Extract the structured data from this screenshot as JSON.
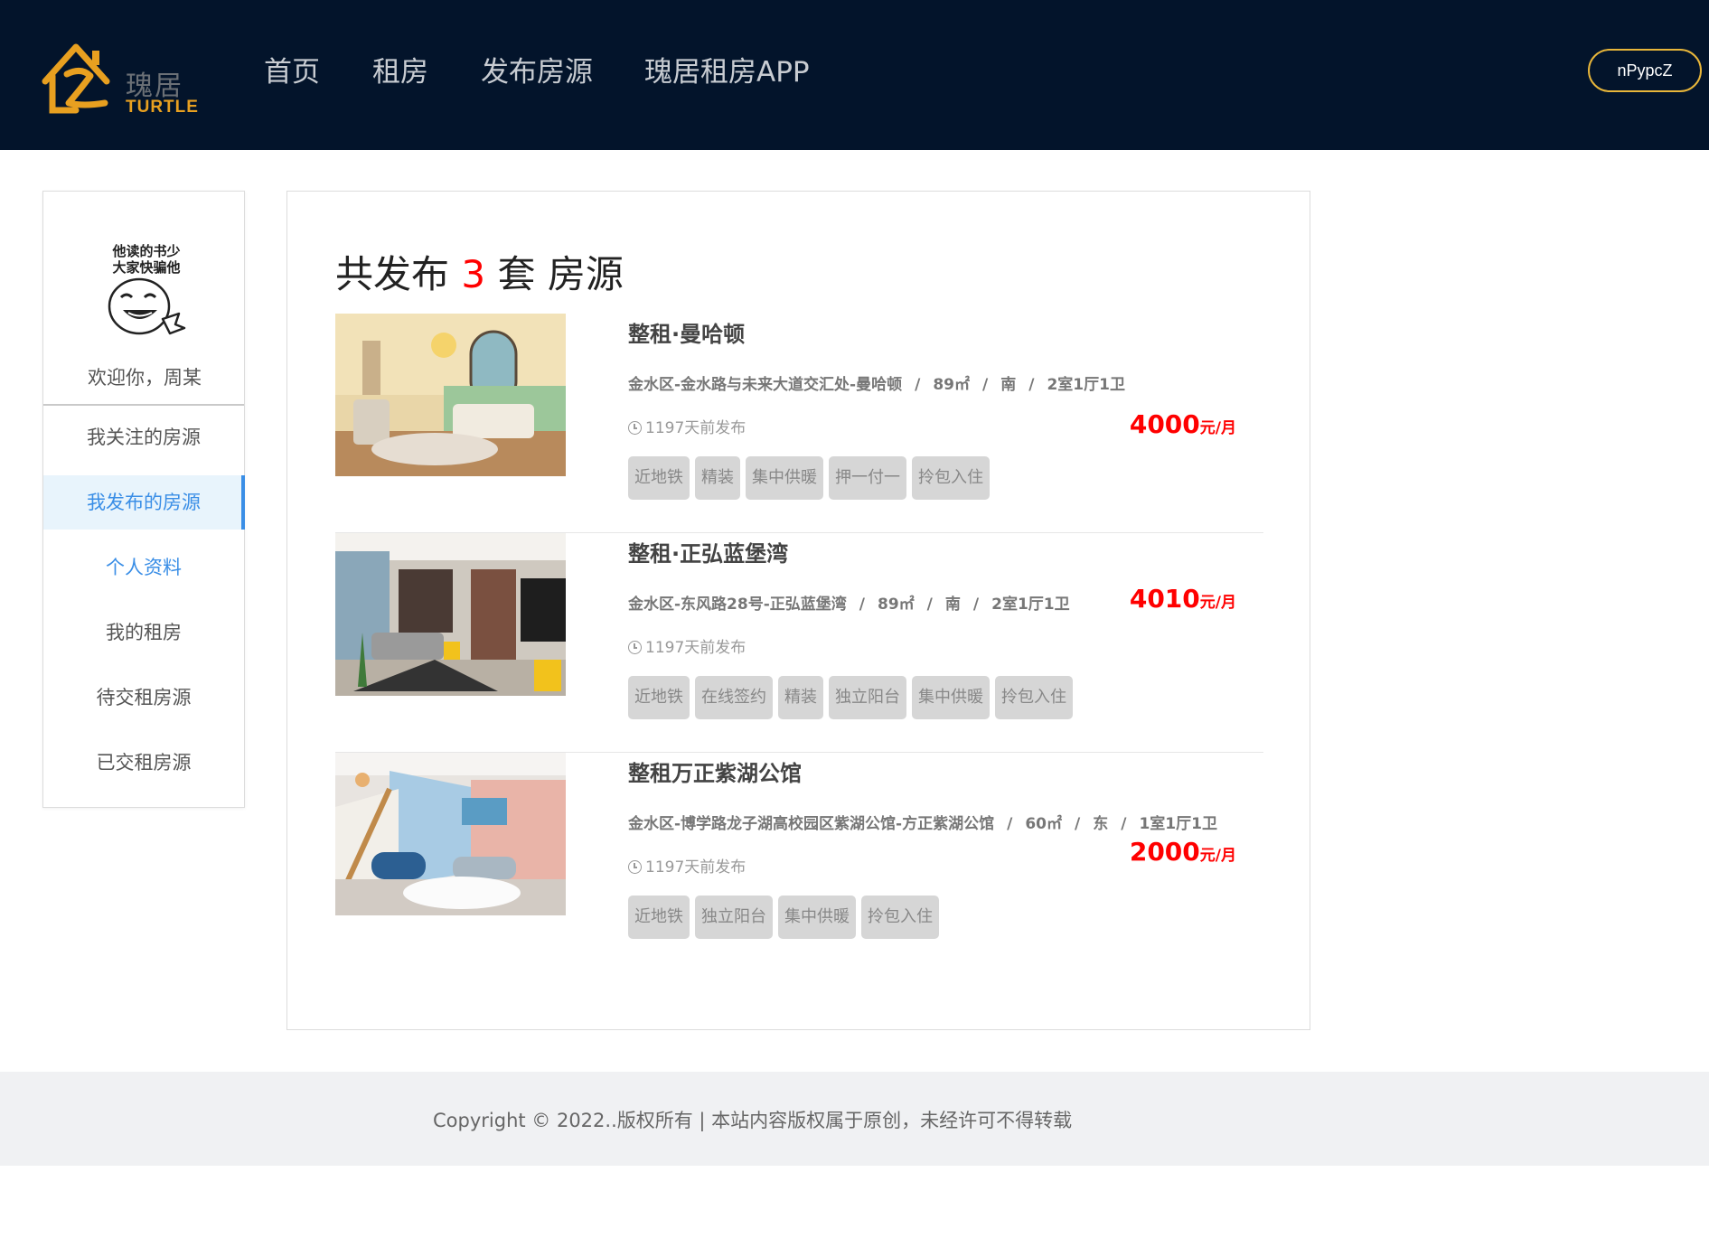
{
  "header": {
    "logo_cn": "瑰居",
    "logo_en": "TURTLE",
    "nav": [
      "首页",
      "租房",
      "发布房源",
      "瑰居租房APP"
    ],
    "user_button": "nPypcZ"
  },
  "sidebar": {
    "avatar_text": [
      "他读的书少",
      "大家快骗他"
    ],
    "welcome": "欢迎你，周某",
    "menu": [
      "我关注的房源",
      "我发布的房源",
      "个人资料",
      "我的租房",
      "待交租房源",
      "已交租房源"
    ],
    "active_index": 1
  },
  "main": {
    "title_prefix": "共发布",
    "count": "3",
    "title_suffix": "套 房源",
    "listings": [
      {
        "title": "整租·曼哈顿",
        "address": "金水区-金水路与未来大道交汇处-曼哈顿",
        "area": "89㎡",
        "orientation": "南",
        "layout": "2室1厅1卫",
        "time": "1197天前发布",
        "price": "4000",
        "price_unit": "元/月",
        "tags": [
          "近地铁",
          "精装",
          "集中供暖",
          "押一付一",
          "拎包入住"
        ]
      },
      {
        "title": "整租·正弘蓝堡湾",
        "address": "金水区-东风路28号-正弘蓝堡湾",
        "area": "89㎡",
        "orientation": "南",
        "layout": "2室1厅1卫",
        "time": "1197天前发布",
        "price": "4010",
        "price_unit": "元/月",
        "tags": [
          "近地铁",
          "在线签约",
          "精装",
          "独立阳台",
          "集中供暖",
          "拎包入住"
        ]
      },
      {
        "title": "整租万正紫湖公馆",
        "address": "金水区-博学路龙子湖高校园区紫湖公馆-方正紫湖公馆",
        "area": "60㎡",
        "orientation": "东",
        "layout": "1室1厅1卫",
        "time": "1197天前发布",
        "price": "2000",
        "price_unit": "元/月",
        "tags": [
          "近地铁",
          "独立阳台",
          "集中供暖",
          "拎包入住"
        ]
      }
    ]
  },
  "footer": {
    "text": "Copyright © 2022..版权所有 | 本站内容版权属于原创，未经许可不得转载"
  },
  "colors": {
    "header_bg": "#03142b",
    "accent_blue": "#3a8ee6",
    "price_red": "#ff0000",
    "button_border": "#e8b63a"
  }
}
